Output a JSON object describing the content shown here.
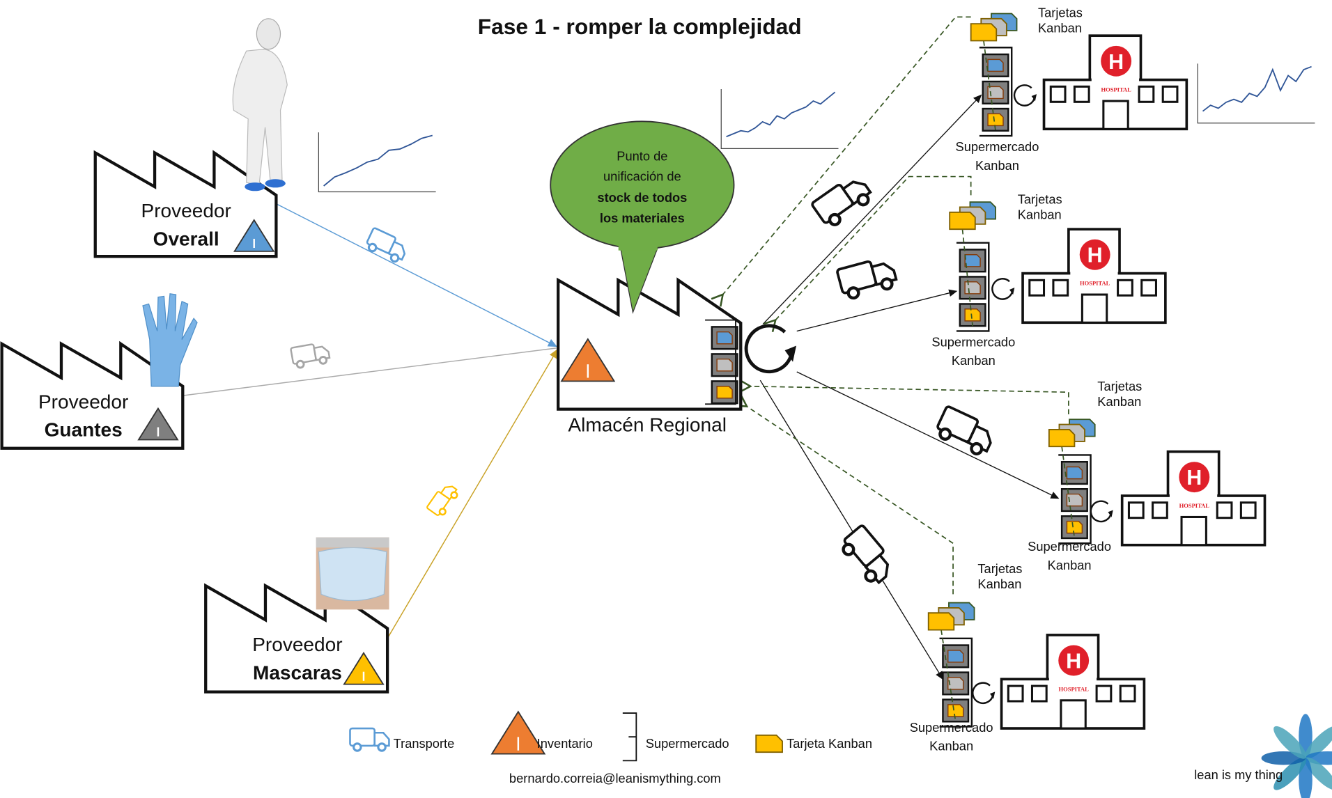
{
  "title": "Fase 1 -  romper la complejidad",
  "suppliers": [
    {
      "line1": "Proveedor",
      "line2": "Overall",
      "triangle_color": "#5b9bd5"
    },
    {
      "line1": "Proveedor",
      "line2": "Guantes",
      "triangle_color": "#7f7f7f"
    },
    {
      "line1": "Proveedor",
      "line2": "Mascaras",
      "triangle_color": "#ffc000"
    }
  ],
  "warehouse": {
    "label": "Almacén Regional",
    "triangle_color": "#ed7d31"
  },
  "bubble": {
    "line1": "Punto de",
    "line2": "unificación de",
    "line3": "stock de todos",
    "line4": "los materiales",
    "color": "#70ad47"
  },
  "supermarket": {
    "line1": "Supermercado",
    "line2": "Kanban"
  },
  "cards": {
    "line1": "Tarjetas",
    "line2": "Kanban"
  },
  "hospital": {
    "label": "HOSPITAL",
    "symbol": "H",
    "color": "#e0202a"
  },
  "legend": {
    "transport": "Transporte",
    "inventory": "Inventario",
    "supermarket": "Supermercado",
    "card": "Tarjeta Kanban"
  },
  "footer": {
    "email": "bernardo.correia@leanismything.com",
    "logo_text": "lean is my thing"
  },
  "colors": {
    "blue": "#5b9bd5",
    "gray": "#a5a5a5",
    "yellow": "#ffc000",
    "orange": "#ed7d31",
    "dashed": "#375623"
  }
}
